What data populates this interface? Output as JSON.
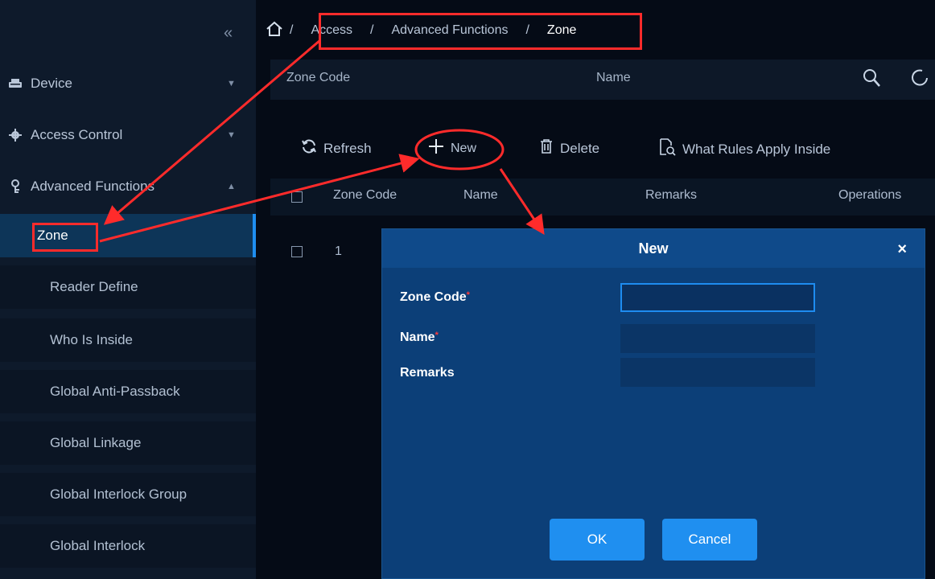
{
  "sidebar": {
    "collapse_icon": "double-chevron-left-icon",
    "items": [
      {
        "label": "Device",
        "icon": "device-icon",
        "chevron": "chevron-down-icon"
      },
      {
        "label": "Access Control",
        "icon": "gear-icon",
        "chevron": "chevron-down-icon"
      },
      {
        "label": "Advanced Functions",
        "icon": "advanced-icon",
        "chevron": "chevron-up-icon"
      }
    ],
    "subitems": [
      {
        "label": "Zone",
        "active": true
      },
      {
        "label": "Reader Define"
      },
      {
        "label": "Who Is Inside"
      },
      {
        "label": "Global Anti-Passback"
      },
      {
        "label": "Global Linkage"
      },
      {
        "label": "Global Interlock Group"
      },
      {
        "label": "Global Interlock"
      }
    ]
  },
  "breadcrumb": {
    "home_icon": "home-icon",
    "sep": "/",
    "parts": [
      "Access",
      "Advanced Functions",
      "Zone"
    ]
  },
  "filter": {
    "zone_code_label": "Zone Code",
    "name_label": "Name"
  },
  "toolbar": {
    "refresh": "Refresh",
    "new": "New",
    "delete": "Delete",
    "rules": "What Rules Apply Inside"
  },
  "table": {
    "columns": [
      "Zone Code",
      "Name",
      "Remarks",
      "Operations"
    ],
    "rows": [
      {
        "zone_code": "1"
      }
    ]
  },
  "dialog": {
    "title": "New",
    "close": "×",
    "required_mark": "*",
    "fields": [
      {
        "label": "Zone Code",
        "required": true,
        "value": ""
      },
      {
        "label": "Name",
        "required": true,
        "value": ""
      },
      {
        "label": "Remarks",
        "required": false,
        "value": ""
      }
    ],
    "ok": "OK",
    "cancel": "Cancel"
  },
  "colors": {
    "accent": "#1f8ff0",
    "annotation": "#ff2b2b",
    "dialog_bg": "#0c3f78"
  }
}
